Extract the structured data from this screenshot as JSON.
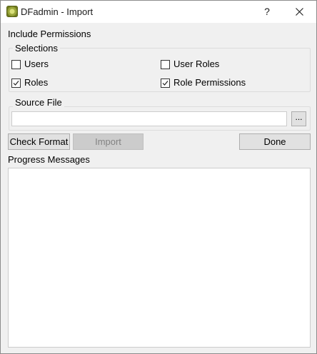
{
  "window": {
    "title": "DFadmin - Import",
    "help_label": "?"
  },
  "permissions": {
    "heading": "Include Permissions",
    "selections_title": "Selections",
    "users": {
      "label": "Users",
      "checked": false
    },
    "user_roles": {
      "label": "User Roles",
      "checked": false
    },
    "roles": {
      "label": "Roles",
      "checked": true
    },
    "role_permissions": {
      "label": "Role Permissions",
      "checked": true
    }
  },
  "source": {
    "title": "Source File",
    "value": "",
    "browse_label": "..."
  },
  "actions": {
    "check_format_label": "Check Format",
    "import_label": "Import",
    "import_enabled": false,
    "done_label": "Done"
  },
  "progress": {
    "label": "Progress Messages",
    "text": ""
  }
}
